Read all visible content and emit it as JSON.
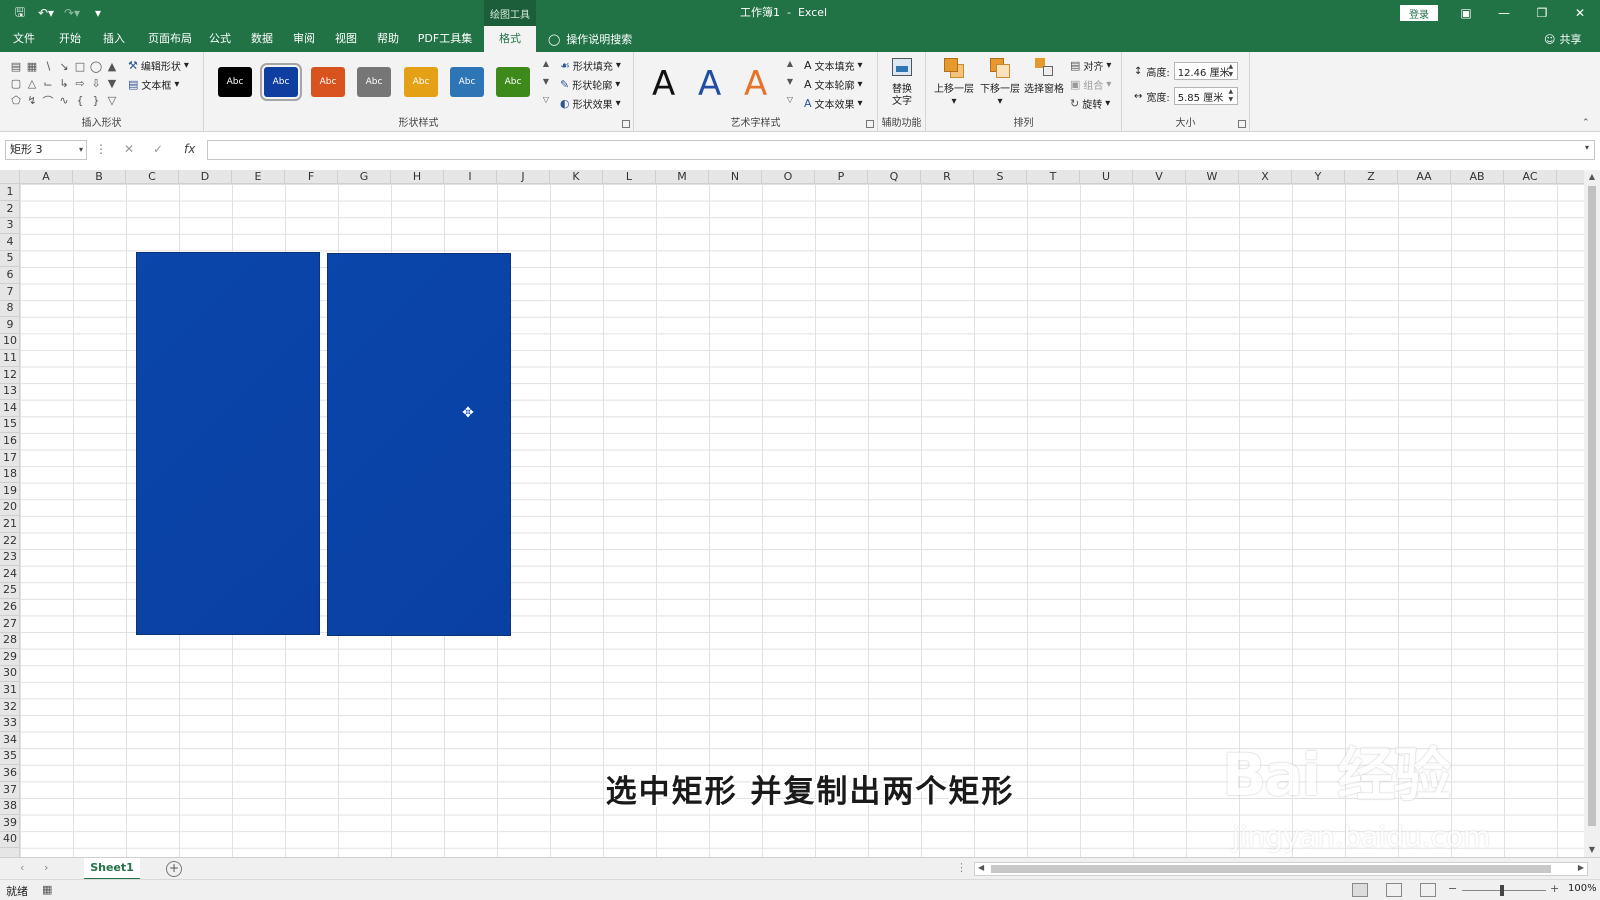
{
  "window": {
    "title": "工作簿1  -  Excel",
    "context_tab_label": "绘图工具",
    "login_label": "登录",
    "qat": {
      "save_icon": "save-icon",
      "undo_icon": "undo-icon",
      "redo_icon": "redo-icon",
      "customize_icon": "customize-qat-icon"
    }
  },
  "tabs": [
    {
      "label": "文件"
    },
    {
      "label": "开始"
    },
    {
      "label": "插入"
    },
    {
      "label": "页面布局"
    },
    {
      "label": "公式"
    },
    {
      "label": "数据"
    },
    {
      "label": "审阅"
    },
    {
      "label": "视图"
    },
    {
      "label": "帮助"
    },
    {
      "label": "PDF工具集"
    },
    {
      "label": "格式",
      "active": true
    }
  ],
  "tell_me": "操作说明搜索",
  "share": "共享",
  "ribbon": {
    "insert_shapes": {
      "label": "插入形状",
      "edit_shape": "编辑形状",
      "text_box": "文本框"
    },
    "shape_styles": {
      "label": "形状样式",
      "swatch_text": "Abc",
      "swatches": [
        {
          "color": "#000000"
        },
        {
          "color": "#0f3ea1",
          "selected": true
        },
        {
          "color": "#d9531e"
        },
        {
          "color": "#767676"
        },
        {
          "color": "#e5a116"
        },
        {
          "color": "#2e75b6"
        },
        {
          "color": "#3d8a1b"
        }
      ],
      "fill": "形状填充",
      "outline": "形状轮廓",
      "effects": "形状效果"
    },
    "wordart": {
      "label": "艺术字样式",
      "letter": "A",
      "colors": [
        "#111111",
        "#1f4ea3",
        "#e5742a"
      ],
      "text_fill": "文本填充",
      "text_outline": "文本轮廓",
      "text_effects": "文本效果"
    },
    "accessibility": {
      "label": "辅助功能",
      "alt_text": "替换文字"
    },
    "arrange": {
      "label": "排列",
      "bring_forward": "上移一层",
      "send_backward": "下移一层",
      "selection_pane": "选择窗格",
      "align": "对齐",
      "group": "组合",
      "rotate": "旋转"
    },
    "size": {
      "label": "大小",
      "height_label": "高度:",
      "height_value": "12.46 厘米",
      "width_label": "宽度:",
      "width_value": "5.85 厘米"
    }
  },
  "formula_bar": {
    "name_box": "矩形 3",
    "fx": "fx",
    "value": ""
  },
  "columns": [
    "A",
    "B",
    "C",
    "D",
    "E",
    "F",
    "G",
    "H",
    "I",
    "J",
    "K",
    "L",
    "M",
    "N",
    "O",
    "P",
    "Q",
    "R",
    "S",
    "T",
    "U",
    "V",
    "W",
    "X",
    "Y",
    "Z",
    "AA",
    "AB",
    "AC"
  ],
  "rows": [
    "1",
    "2",
    "3",
    "4",
    "5",
    "6",
    "7",
    "8",
    "9",
    "10",
    "11",
    "12",
    "13",
    "14",
    "15",
    "16",
    "17",
    "18",
    "19",
    "20",
    "21",
    "22",
    "23",
    "24",
    "25",
    "26",
    "27",
    "28",
    "29",
    "30",
    "31",
    "32",
    "33",
    "34",
    "35",
    "36",
    "37",
    "38",
    "39",
    "40"
  ],
  "shapes": [
    {
      "name": "矩形 1",
      "color": "#0a45a8"
    },
    {
      "name": "矩形 3",
      "color": "#0a45a8"
    }
  ],
  "subtitle": "选中矩形 并复制出两个矩形",
  "watermark": {
    "logo": "Bai 经验",
    "url": "jingyan.baidu.com"
  },
  "sheets": [
    {
      "label": "Sheet1",
      "active": true
    }
  ],
  "status": {
    "ready": "就绪",
    "zoom": "100%"
  }
}
